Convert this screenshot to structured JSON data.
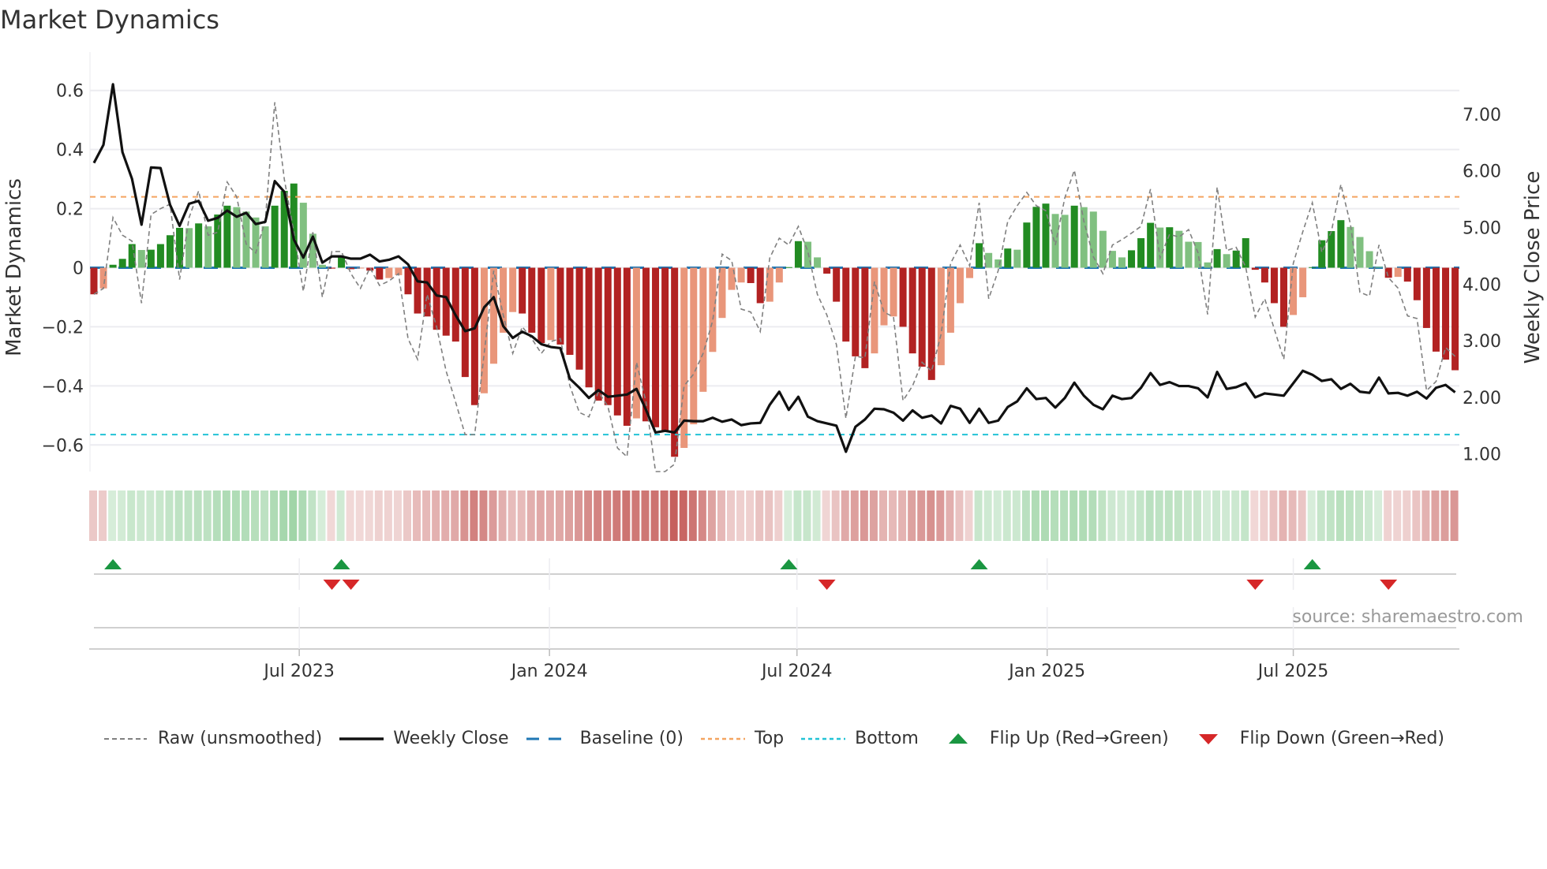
{
  "title": "Market Dynamics",
  "source": "source: sharemaestro.com",
  "legend": [
    {
      "key": "raw",
      "label": "Raw (unsmoothed)"
    },
    {
      "key": "close",
      "label": "Weekly Close"
    },
    {
      "key": "baseline",
      "label": "Baseline (0)"
    },
    {
      "key": "top",
      "label": "Top"
    },
    {
      "key": "bottom",
      "label": "Bottom"
    },
    {
      "key": "flip_up",
      "label": "Flip Up (Red→Green)"
    },
    {
      "key": "flip_down",
      "label": "Flip Down (Green→Red)"
    }
  ],
  "colors": {
    "pos_rising": "#228b22",
    "pos_falling": "#80c080",
    "neg_falling": "#b22222",
    "neg_rising": "#e9967a",
    "raw": "#808080",
    "close": "#111111",
    "baseline": "#1f77b4",
    "top": "#f4a460",
    "bottom": "#22c3d6",
    "flip_up": "#1a9641",
    "flip_down": "#d62728",
    "heat_green": "#4caf5a",
    "heat_red": "#c0504d",
    "grid": "#ececf0"
  },
  "chart_data": {
    "type": "bar",
    "title": "Market Dynamics",
    "ylabel": "Market Dynamics",
    "y2label": "Weekly Close Price",
    "ylim": [
      -0.69,
      0.69
    ],
    "y2lim": [
      0.69,
      7.89
    ],
    "yticks": [
      {
        "v": 0.6,
        "label": "0.6"
      },
      {
        "v": 0.4,
        "label": "0.4"
      },
      {
        "v": 0.2,
        "label": "0.2"
      },
      {
        "v": 0,
        "label": "0"
      },
      {
        "v": -0.2,
        "label": "−0.2"
      },
      {
        "v": -0.4,
        "label": "−0.4"
      },
      {
        "v": -0.6,
        "label": "−0.6"
      }
    ],
    "y2ticks": [
      {
        "v": 7,
        "label": "7.00"
      },
      {
        "v": 6,
        "label": "6.00"
      },
      {
        "v": 5,
        "label": "5.00"
      },
      {
        "v": 4,
        "label": "4.00"
      },
      {
        "v": 3,
        "label": "3.00"
      },
      {
        "v": 2,
        "label": "2.00"
      },
      {
        "v": 1,
        "label": "1.00"
      }
    ],
    "xticks": [
      {
        "date": "2023-07-01",
        "label": "Jul 2023"
      },
      {
        "date": "2024-01-01",
        "label": "Jan 2024"
      },
      {
        "date": "2024-07-01",
        "label": "Jul 2024"
      },
      {
        "date": "2025-01-01",
        "label": "Jan 2025"
      },
      {
        "date": "2025-07-01",
        "label": "Jul 2025"
      }
    ],
    "x_start": "2023-01-31",
    "x_step_days": 7,
    "top_level": 0.24,
    "bottom_level": -0.565,
    "baseline": 0,
    "smoothed": [
      -0.09,
      -0.07,
      0.01,
      0.03,
      0.08,
      0.06,
      0.061,
      0.08,
      0.11,
      0.135,
      0.134,
      0.15,
      0.14,
      0.18,
      0.21,
      0.205,
      0.19,
      0.17,
      0.14,
      0.21,
      0.26,
      0.285,
      0.22,
      0.115,
      0.01,
      -0.003,
      0.04,
      -0.005,
      -0.002,
      -0.01,
      -0.04,
      -0.035,
      -0.025,
      -0.09,
      -0.155,
      -0.165,
      -0.21,
      -0.23,
      -0.25,
      -0.37,
      -0.465,
      -0.425,
      -0.325,
      -0.22,
      -0.15,
      -0.155,
      -0.22,
      -0.255,
      -0.245,
      -0.26,
      -0.295,
      -0.345,
      -0.405,
      -0.45,
      -0.465,
      -0.5,
      -0.535,
      -0.51,
      -0.52,
      -0.54,
      -0.55,
      -0.64,
      -0.61,
      -0.53,
      -0.42,
      -0.285,
      -0.17,
      -0.075,
      -0.05,
      -0.052,
      -0.12,
      -0.115,
      -0.05,
      0.002,
      0.09,
      0.088,
      0.035,
      -0.02,
      -0.115,
      -0.25,
      -0.3,
      -0.34,
      -0.29,
      -0.195,
      -0.165,
      -0.2,
      -0.29,
      -0.335,
      -0.38,
      -0.33,
      -0.22,
      -0.12,
      -0.035,
      0.083,
      0.05,
      0.028,
      0.065,
      0.061,
      0.153,
      0.206,
      0.217,
      0.182,
      0.179,
      0.21,
      0.205,
      0.19,
      0.125,
      0.057,
      0.035,
      0.059,
      0.1,
      0.152,
      0.136,
      0.137,
      0.125,
      0.088,
      0.087,
      0.018,
      0.063,
      0.046,
      0.058,
      0.1,
      -0.007,
      -0.05,
      -0.12,
      -0.2,
      -0.16,
      -0.1,
      0.002,
      0.093,
      0.124,
      0.161,
      0.138,
      0.104,
      0.056,
      0.003,
      -0.034,
      -0.031,
      -0.047,
      -0.11,
      -0.204,
      -0.284,
      -0.311,
      -0.347
    ],
    "raw": [
      -0.09,
      -0.07,
      0.17,
      0.11,
      0.09,
      -0.12,
      0.18,
      0.2,
      0.215,
      -0.04,
      0.17,
      0.26,
      0.11,
      0.12,
      0.29,
      0.24,
      0.08,
      0.05,
      0.16,
      0.56,
      0.3,
      0.12,
      -0.08,
      0.12,
      -0.1,
      0.055,
      0.055,
      -0.02,
      -0.07,
      0,
      -0.06,
      -0.045,
      -0.02,
      -0.24,
      -0.31,
      -0.09,
      -0.2,
      -0.35,
      -0.455,
      -0.565,
      -0.565,
      -0.29,
      -0.01,
      -0.16,
      -0.29,
      -0.2,
      -0.24,
      -0.29,
      -0.25,
      -0.24,
      -0.4,
      -0.49,
      -0.505,
      -0.42,
      -0.47,
      -0.61,
      -0.64,
      -0.32,
      -0.455,
      -0.69,
      -0.69,
      -0.665,
      -0.4,
      -0.36,
      -0.29,
      -0.18,
      0.046,
      0.024,
      -0.14,
      -0.15,
      -0.216,
      0.033,
      0.1,
      0.077,
      0.14,
      0.055,
      -0.09,
      -0.16,
      -0.26,
      -0.51,
      -0.3,
      -0.305,
      -0.047,
      -0.15,
      -0.167,
      -0.45,
      -0.4,
      -0.32,
      -0.35,
      -0.225,
      0.015,
      0.077,
      0.006,
      0.22,
      -0.105,
      -0.01,
      0.157,
      0.21,
      0.255,
      0.21,
      0.193,
      0.077,
      0.237,
      0.33,
      0.157,
      0.037,
      -0.02,
      0.077,
      0.095,
      0.117,
      0.14,
      0.266,
      0.033,
      0.113,
      0.104,
      0.129,
      0.05,
      -0.158,
      0.273,
      0.058,
      0.069,
      0.002,
      -0.167,
      -0.105,
      -0.207,
      -0.31,
      0.015,
      0.122,
      0.22,
      0.052,
      0.122,
      0.282,
      0.148,
      -0.083,
      -0.096,
      0.077,
      -0.034,
      -0.069,
      -0.163,
      -0.172,
      -0.416,
      -0.385,
      -0.27,
      -0.3
    ],
    "close": [
      6.14,
      6.46,
      7.53,
      6.33,
      5.86,
      5.05,
      6.06,
      6.05,
      5.4,
      5.03,
      5.42,
      5.47,
      5.12,
      5.17,
      5.3,
      5.19,
      5.26,
      5.06,
      5.1,
      5.82,
      5.63,
      4.79,
      4.47,
      4.84,
      4.38,
      4.49,
      4.49,
      4.45,
      4.45,
      4.52,
      4.4,
      4.43,
      4.49,
      4.35,
      4.05,
      4.03,
      3.8,
      3.77,
      3.45,
      3.17,
      3.22,
      3.59,
      3.77,
      3.26,
      3.05,
      3.16,
      3.08,
      2.94,
      2.89,
      2.87,
      2.33,
      2.17,
      1.99,
      2.13,
      2.01,
      2.03,
      2.05,
      2.15,
      1.78,
      1.38,
      1.41,
      1.38,
      1.59,
      1.58,
      1.58,
      1.64,
      1.57,
      1.61,
      1.51,
      1.54,
      1.55,
      1.87,
      2.1,
      1.78,
      2.01,
      1.66,
      1.58,
      1.54,
      1.5,
      1.04,
      1.48,
      1.61,
      1.8,
      1.79,
      1.73,
      1.59,
      1.77,
      1.64,
      1.68,
      1.54,
      1.85,
      1.8,
      1.55,
      1.8,
      1.55,
      1.59,
      1.83,
      1.93,
      2.16,
      1.97,
      1.99,
      1.82,
      1.99,
      2.26,
      2.03,
      1.87,
      1.79,
      2.03,
      1.97,
      1.99,
      2.17,
      2.43,
      2.22,
      2.27,
      2.2,
      2.2,
      2.16,
      2.0,
      2.45,
      2.15,
      2.18,
      2.25,
      2.0,
      2.07,
      2.05,
      2.03,
      2.25,
      2.47,
      2.4,
      2.29,
      2.32,
      2.15,
      2.24,
      2.1,
      2.08,
      2.35,
      2.07,
      2.08,
      2.03,
      2.1,
      1.98,
      2.17,
      2.22,
      2.09
    ]
  }
}
